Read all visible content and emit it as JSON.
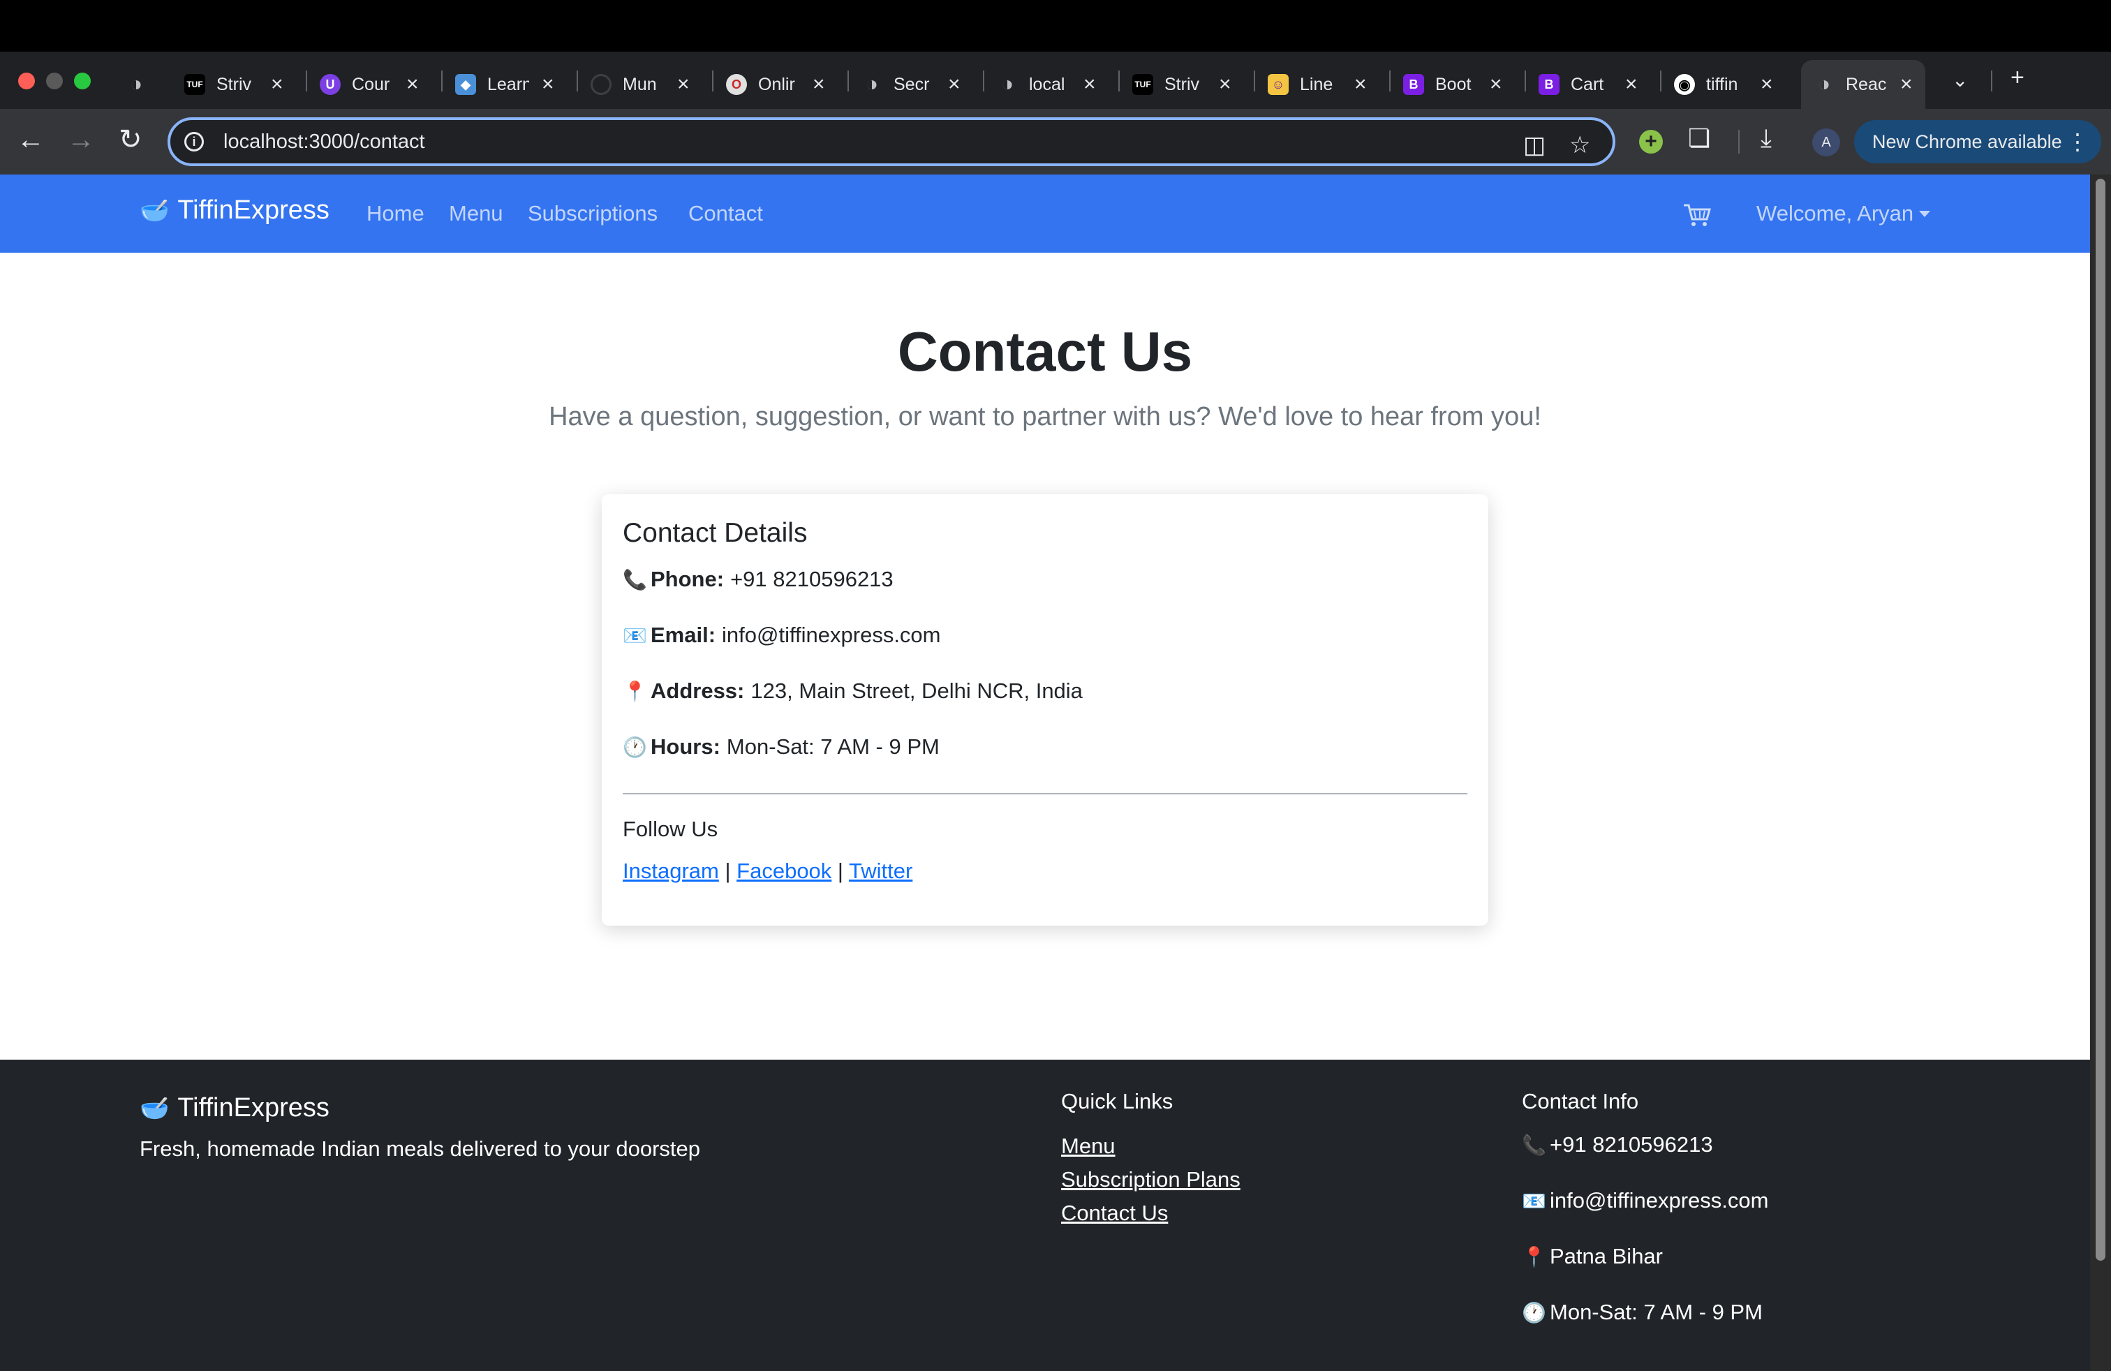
{
  "browser": {
    "tabs": [
      {
        "title": "Striv",
        "icon": "tuf-icon"
      },
      {
        "title": "Cour",
        "icon": "course-icon"
      },
      {
        "title": "Learn",
        "icon": "learn-icon"
      },
      {
        "title": "Mun",
        "icon": "loading-icon"
      },
      {
        "title": "Onlir",
        "icon": "opera-icon"
      },
      {
        "title": "Secr",
        "icon": "globe-icon"
      },
      {
        "title": "local",
        "icon": "globe-icon"
      },
      {
        "title": "Striv",
        "icon": "tuf-icon"
      },
      {
        "title": "Line",
        "icon": "line-icon"
      },
      {
        "title": "Boot",
        "icon": "bootstrap-icon"
      },
      {
        "title": "Cart",
        "icon": "bootstrap-icon"
      },
      {
        "title": "tiffin",
        "icon": "github-icon"
      },
      {
        "title": "Reac",
        "icon": "globe-icon"
      }
    ],
    "url": "localhost:3000/contact",
    "profile_initial": "A",
    "update_label": "New Chrome available"
  },
  "navbar": {
    "brand": "TiffinExpress",
    "links": [
      "Home",
      "Menu",
      "Subscriptions",
      "Contact"
    ],
    "user_greeting": "Welcome, Aryan"
  },
  "hero": {
    "title": "Contact Us",
    "subtitle": "Have a question, suggestion, or want to partner with us? We'd love to hear from you!"
  },
  "contact_card": {
    "title": "Contact Details",
    "phone_label": "Phone:",
    "phone": "+91 8210596213",
    "email_label": "Email:",
    "email": "info@tiffinexpress.com",
    "address_label": "Address:",
    "address": "123, Main Street, Delhi NCR, India",
    "hours_label": "Hours:",
    "hours": "Mon-Sat: 7 AM - 9 PM",
    "follow_title": "Follow Us",
    "social": [
      "Instagram",
      "Facebook",
      "Twitter"
    ],
    "separator": "|"
  },
  "footer": {
    "brand": "TiffinExpress",
    "tagline": "Fresh, homemade Indian meals delivered to your doorstep",
    "quick_links_title": "Quick Links",
    "quick_links": [
      "Menu",
      "Subscription Plans",
      "Contact Us"
    ],
    "contact_title": "Contact Info",
    "phone": "+91 8210596213",
    "email": "info@tiffinexpress.com",
    "location": "Patna Bihar",
    "hours": "Mon-Sat: 7 AM - 9 PM"
  },
  "colors": {
    "navbar": "#3474f0",
    "footer": "#212529",
    "link": "#0d6efd"
  }
}
